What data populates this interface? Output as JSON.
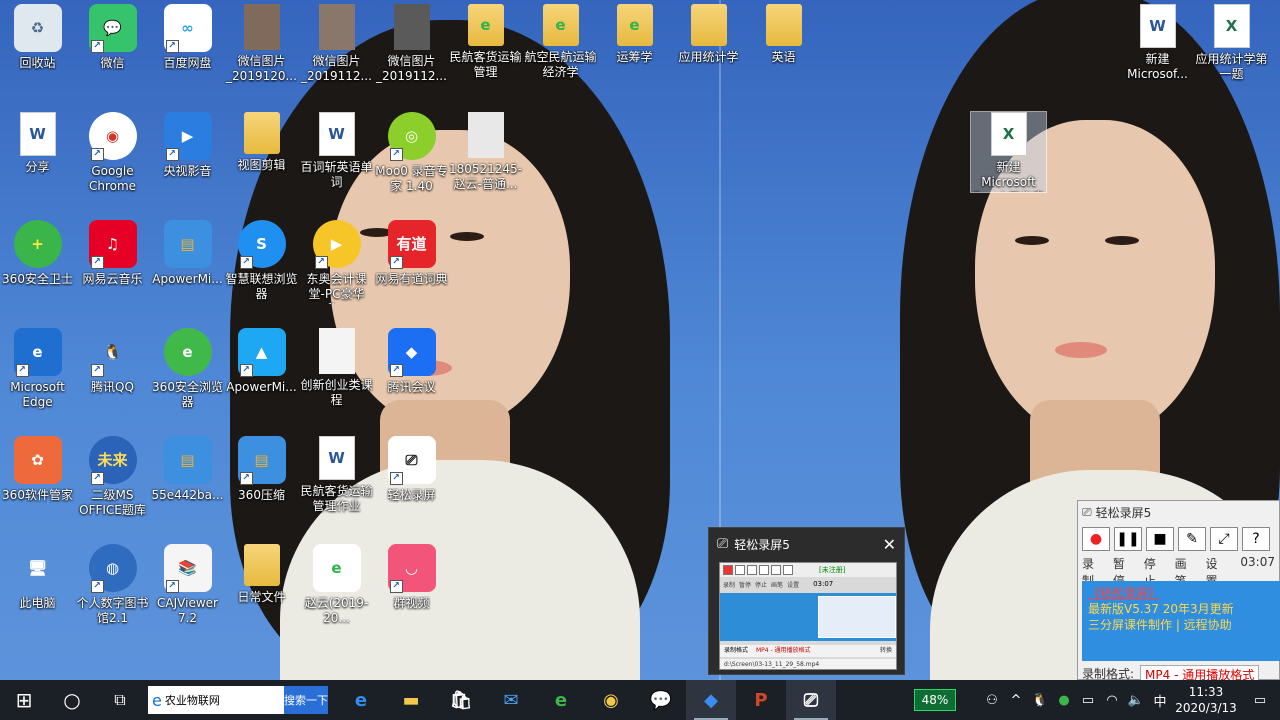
{
  "desktop_icons": [
    {
      "label": "回收站",
      "glyph": "♻",
      "bg": "#dfe7ef",
      "fg": "#4a6a8a",
      "kind": "square",
      "shortcut": false
    },
    {
      "label": "微信",
      "glyph": "💬",
      "bg": "#35c36b",
      "fg": "#ffffff",
      "kind": "square",
      "shortcut": true
    },
    {
      "label": "百度网盘",
      "glyph": "∞",
      "bg": "#ffffff",
      "fg": "#2aa3f0",
      "kind": "square",
      "shortcut": true
    },
    {
      "label": "微信图片_2019120...",
      "glyph": "",
      "bg": "#7f6a5c",
      "fg": "#fff",
      "kind": "photo",
      "shortcut": false
    },
    {
      "label": "微信图片_2019112...",
      "glyph": "",
      "bg": "#8a776b",
      "fg": "#fff",
      "kind": "photo",
      "shortcut": false
    },
    {
      "label": "微信图片_2019112...",
      "glyph": "",
      "bg": "#5a5a5a",
      "fg": "#fff",
      "kind": "photo",
      "shortcut": false
    },
    {
      "label": "民航客货运输管理",
      "glyph": "e",
      "bg": "",
      "fg": "#2fb34a",
      "kind": "folder",
      "shortcut": false
    },
    {
      "label": "航空民航运输经济学",
      "glyph": "e",
      "bg": "",
      "fg": "#2fb34a",
      "kind": "folder",
      "shortcut": false
    },
    {
      "label": "运筹学",
      "glyph": "e",
      "bg": "",
      "fg": "#2fb34a",
      "kind": "folder",
      "shortcut": false
    },
    {
      "label": "应用统计学",
      "glyph": "",
      "bg": "",
      "fg": "#fff",
      "kind": "folder",
      "shortcut": false
    },
    {
      "label": "英语",
      "glyph": "",
      "bg": "",
      "fg": "#fff",
      "kind": "folder",
      "shortcut": false
    },
    {
      "label": "新建 Microsof...",
      "glyph": "W",
      "bg": "",
      "fg": "",
      "kind": "word",
      "shortcut": false
    },
    {
      "label": "应用统计学第一题",
      "glyph": "X",
      "bg": "",
      "fg": "",
      "kind": "excel",
      "shortcut": false
    },
    {
      "label": "分享",
      "glyph": "W",
      "bg": "",
      "fg": "",
      "kind": "word",
      "shortcut": false
    },
    {
      "label": "Google Chrome",
      "glyph": "◉",
      "bg": "#ffffff",
      "fg": "#d93025",
      "kind": "round",
      "shortcut": true
    },
    {
      "label": "央视影音",
      "glyph": "▶",
      "bg": "#2b7de0",
      "fg": "#ffffff",
      "kind": "square",
      "shortcut": true
    },
    {
      "label": "视图剪辑",
      "glyph": "",
      "bg": "",
      "fg": "#fff",
      "kind": "folder",
      "shortcut": false
    },
    {
      "label": "百词斩英语单词",
      "glyph": "W",
      "bg": "",
      "fg": "",
      "kind": "word",
      "shortcut": false
    },
    {
      "label": "Moo0 录音专家 1.40",
      "glyph": "◎",
      "bg": "#8ccf2b",
      "fg": "#ffffff",
      "kind": "round",
      "shortcut": true
    },
    {
      "label": "180521245-赵云-普通...",
      "glyph": "",
      "bg": "#e8e8e8",
      "fg": "#888",
      "kind": "photo",
      "shortcut": false
    },
    {
      "label": "新建 Microsoft Excel 工作表",
      "glyph": "X",
      "bg": "",
      "fg": "",
      "kind": "excel",
      "shortcut": false,
      "selected": true
    },
    {
      "label": "360安全卫士",
      "glyph": "+",
      "bg": "#39b54a",
      "fg": "#ffeb3b",
      "kind": "round",
      "shortcut": false
    },
    {
      "label": "网易云音乐",
      "glyph": "♫",
      "bg": "#e60026",
      "fg": "#ffffff",
      "kind": "square",
      "shortcut": true
    },
    {
      "label": "ApowerMi...",
      "glyph": "▤",
      "bg": "#3d8fe0",
      "fg": "#f0b030",
      "kind": "square",
      "shortcut": false
    },
    {
      "label": "智慧联想浏览器",
      "glyph": "S",
      "bg": "#1f8ff0",
      "fg": "#ffffff",
      "kind": "round",
      "shortcut": true
    },
    {
      "label": "东奥会计课堂-PC豪华升...",
      "glyph": "▶",
      "bg": "#f6c629",
      "fg": "#ffffff",
      "kind": "round",
      "shortcut": true
    },
    {
      "label": "网易有道词典",
      "glyph": "有道",
      "bg": "#e5252a",
      "fg": "#ffffff",
      "kind": "square",
      "shortcut": true
    },
    {
      "label": "Microsoft Edge",
      "glyph": "e",
      "bg": "#1f6fd0",
      "fg": "#ffffff",
      "kind": "square",
      "shortcut": true
    },
    {
      "label": "腾讯QQ",
      "glyph": "🐧",
      "bg": "transparent",
      "fg": "#000",
      "kind": "square",
      "shortcut": true
    },
    {
      "label": "360安全浏览器",
      "glyph": "e",
      "bg": "#41b84a",
      "fg": "#ffffff",
      "kind": "round",
      "shortcut": false
    },
    {
      "label": "ApowerMi...",
      "glyph": "▲",
      "bg": "#1ea7f2",
      "fg": "#ffffff",
      "kind": "square",
      "shortcut": true
    },
    {
      "label": "创新创业类课程",
      "glyph": "",
      "bg": "#f4f4f4",
      "fg": "#999",
      "kind": "photo",
      "shortcut": false
    },
    {
      "label": "腾讯会议",
      "glyph": "◆",
      "bg": "#1c6ef2",
      "fg": "#ffffff",
      "kind": "square",
      "shortcut": true
    },
    {
      "label": "360软件管家",
      "glyph": "✿",
      "bg": "#ef6a3a",
      "fg": "#ffffff",
      "kind": "square",
      "shortcut": false
    },
    {
      "label": "二级MS OFFICE题库",
      "glyph": "未来",
      "bg": "#2a63b8",
      "fg": "#ffdd55",
      "kind": "round",
      "shortcut": true
    },
    {
      "label": "55e442ba...",
      "glyph": "▤",
      "bg": "#3d8fe0",
      "fg": "#f0b030",
      "kind": "square",
      "shortcut": false
    },
    {
      "label": "360压缩",
      "glyph": "▤",
      "bg": "#3d8fe0",
      "fg": "#f0b030",
      "kind": "square",
      "shortcut": true
    },
    {
      "label": "民航客货运输管理作业",
      "glyph": "W",
      "bg": "",
      "fg": "",
      "kind": "word",
      "shortcut": false
    },
    {
      "label": "轻松录屏",
      "glyph": "⎚",
      "bg": "#ffffff",
      "fg": "#222",
      "kind": "square",
      "shortcut": true
    },
    {
      "label": "此电脑",
      "glyph": "🖥",
      "bg": "transparent",
      "fg": "#fff",
      "kind": "square",
      "shortcut": false
    },
    {
      "label": "个人数字图书馆2.1",
      "glyph": "◍",
      "bg": "#2f6cc0",
      "fg": "#ffffff",
      "kind": "round",
      "shortcut": true
    },
    {
      "label": "CAJViewer 7.2",
      "glyph": "📚",
      "bg": "#f5f5f5",
      "fg": "#333",
      "kind": "square",
      "shortcut": true
    },
    {
      "label": "日常文件",
      "glyph": "",
      "bg": "",
      "fg": "#fff",
      "kind": "folder",
      "shortcut": false
    },
    {
      "label": "赵云(2019-20...",
      "glyph": "e",
      "bg": "#ffffff",
      "fg": "#2fb34a",
      "kind": "square",
      "shortcut": false
    },
    {
      "label": "群视频",
      "glyph": "◡",
      "bg": "#f2547a",
      "fg": "#ffffff",
      "kind": "square",
      "shortcut": true
    }
  ],
  "popup": {
    "title": "轻松录屏5",
    "close": "✕",
    "thumb_lines": [
      "录制",
      "暂停",
      "停止",
      "画笔",
      "设置"
    ],
    "thumb_unregistered": "[未注册]",
    "thumb_time": "03:07",
    "thumb_format": "MP4 - 通用播放格式",
    "thumb_path": "d:\\Screen\\03-13_11_29_58.mp4",
    "thumb_format_label": "录制格式",
    "thumb_convert": "转换"
  },
  "app": {
    "title": "轻松录屏5",
    "toolbar_icons": [
      "●",
      "❚❚",
      "■",
      "✎",
      "⤢",
      "?"
    ],
    "labels": [
      "录制",
      "暂停",
      "停止",
      "画笔",
      "设置"
    ],
    "time": "03:07",
    "brand": "《轻松录屏》",
    "version": "最新版V5.37 20年3月更新",
    "tagline": "三分屏课件制作 | 远程协助",
    "format_label": "录制格式:",
    "format_value": "MP4 - 通用播放格式"
  },
  "taskbar": {
    "start_icon": "⊞",
    "cortana_icon": "○",
    "taskview_icon": "⧉",
    "search_text": "农业物联网",
    "search_button": "搜索一下",
    "apps": [
      {
        "name": "edge",
        "glyph": "e",
        "color": "#2f8cf0",
        "active": false
      },
      {
        "name": "explorer",
        "glyph": "▬",
        "color": "#f2c94c",
        "active": false
      },
      {
        "name": "store",
        "glyph": "🛍",
        "color": "#ffffff",
        "active": false
      },
      {
        "name": "mail",
        "glyph": "✉",
        "color": "#4aa3f5",
        "active": false
      },
      {
        "name": "360browser",
        "glyph": "e",
        "color": "#3cb54a",
        "active": false
      },
      {
        "name": "chrome",
        "glyph": "◉",
        "color": "#f2c94c",
        "active": false
      },
      {
        "name": "wechat",
        "glyph": "💬",
        "color": "#35c36b",
        "active": false
      },
      {
        "name": "tencent-meeting",
        "glyph": "◆",
        "color": "#3a8df5",
        "active": true
      },
      {
        "name": "powerpoint",
        "glyph": "P",
        "color": "#d24726",
        "active": false
      },
      {
        "name": "screen-recorder",
        "glyph": "⎚",
        "color": "#ffffff",
        "active": true
      }
    ],
    "battery": "48%",
    "ime": "中",
    "time": "11:33",
    "date": "2020/3/13"
  }
}
